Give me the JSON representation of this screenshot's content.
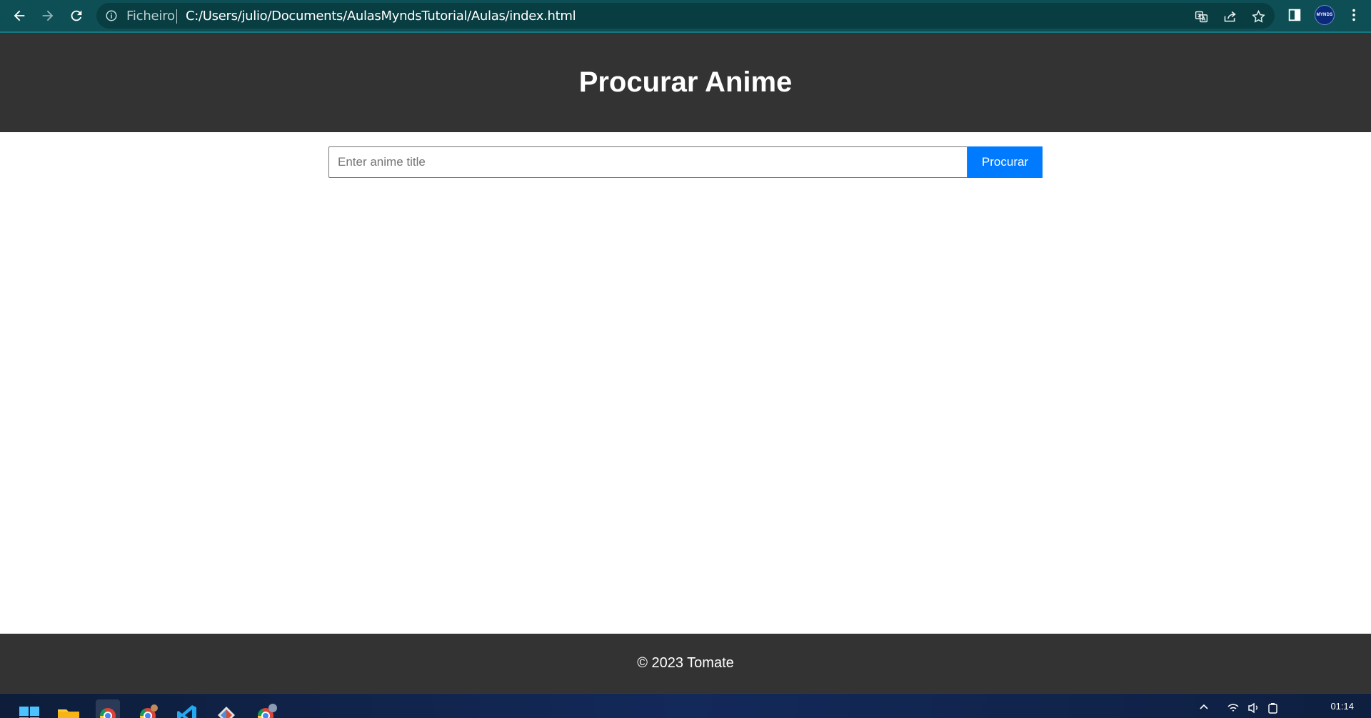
{
  "browser": {
    "omnibox": {
      "scheme_label": "Ficheiro",
      "url": "C:/Users/julio/Documents/AulasMyndsTutorial/Aulas/index.html"
    },
    "profile_label": "MYNDS"
  },
  "page": {
    "title": "Procurar Anime",
    "search": {
      "placeholder": "Enter anime title",
      "value": "",
      "button_label": "Procurar"
    },
    "footer_text": "© 2023 Tomate"
  },
  "taskbar": {
    "apps": [
      "start-menu",
      "file-explorer",
      "chrome-mynds",
      "chrome",
      "vscode",
      "git-extensions",
      "chrome-profile"
    ],
    "clock_time": "01:14"
  },
  "colors": {
    "chrome_bg": "#0e4f55",
    "header_bg": "#333333",
    "accent": "#007bff"
  }
}
